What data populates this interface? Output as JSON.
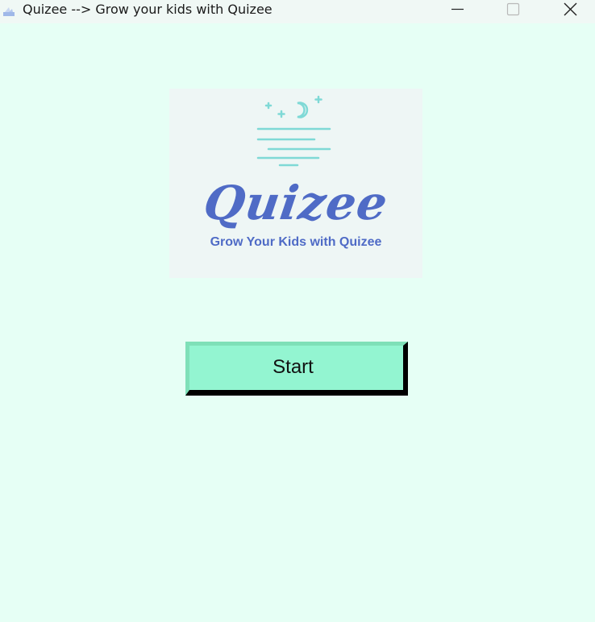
{
  "window": {
    "title": "Quizee --> Grow your kids with Quizee",
    "icon": "feather-app-icon",
    "controls": [
      "minimize-icon",
      "maximize-icon",
      "close-icon"
    ]
  },
  "logo": {
    "wordmark": "Quizee",
    "tagline": "Grow Your Kids with Quizee",
    "icon": "moon-stars-wind-icon",
    "colors": {
      "text": "#4f6bc6",
      "lines": "#7fd9d6",
      "background": "#eef6f5"
    }
  },
  "actions": {
    "start_label": "Start"
  },
  "colors": {
    "window_background": "#e6fff5",
    "button_face": "#93f5d1",
    "button_shadow": "#000000"
  }
}
